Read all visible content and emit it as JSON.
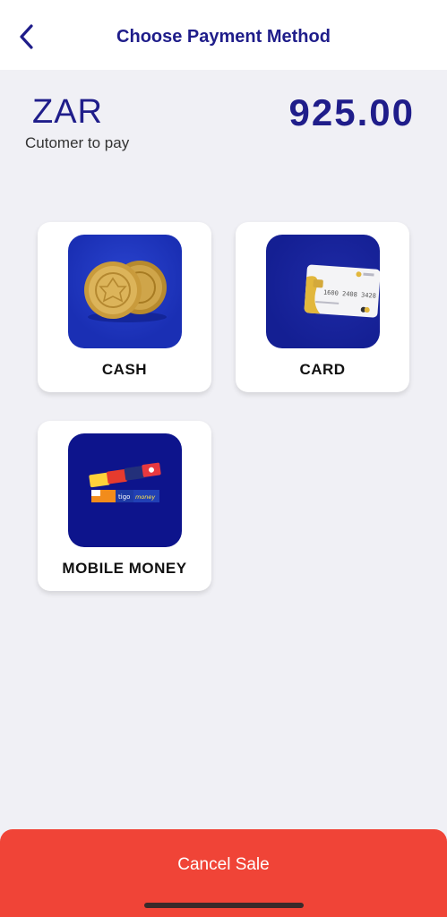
{
  "header": {
    "title": "Choose Payment Method",
    "back_icon": "chevron-left-icon"
  },
  "summary": {
    "currency": "ZAR",
    "subtitle": "Cutomer to pay",
    "amount": "925.00"
  },
  "methods": [
    {
      "label": "CASH",
      "icon": "coins-image"
    },
    {
      "label": "CARD",
      "icon": "credit-card-image"
    },
    {
      "label": "MOBILE MONEY",
      "icon": "mobile-money-image"
    }
  ],
  "footer": {
    "cancel_label": "Cancel Sale"
  },
  "colors": {
    "accent": "#1f1d8a",
    "tile_cash": "#1a2fb4",
    "tile_card": "#141f93",
    "tile_mobile": "#0d148c",
    "cancel": "#f04437",
    "background": "#f0f0f5"
  }
}
